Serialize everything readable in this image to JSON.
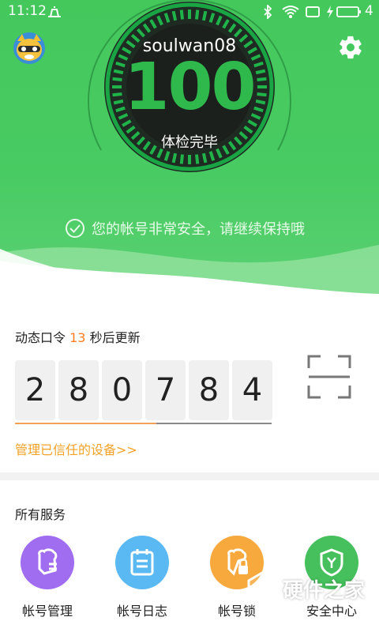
{
  "statusbar": {
    "time": "11:12",
    "battery": "4"
  },
  "profile": {
    "username": "soulwan08"
  },
  "checkup": {
    "score": "100",
    "label": "体检完毕",
    "message": "您的帐号非常安全，请继续保持哦"
  },
  "token": {
    "title_prefix": "动态口令",
    "countdown": "13",
    "title_suffix": "秒后更新",
    "digits": [
      "2",
      "8",
      "0",
      "7",
      "8",
      "4"
    ],
    "progress": 0.55
  },
  "trusted_link": "管理已信任的设备>>",
  "services": {
    "title": "所有服务",
    "items": [
      {
        "label": "帐号管理",
        "color": "#a06cf0",
        "icon": "account-manage-icon"
      },
      {
        "label": "帐号日志",
        "color": "#5ab8f2",
        "icon": "account-log-icon"
      },
      {
        "label": "帐号锁",
        "color": "#f7a93d",
        "icon": "account-lock-icon"
      },
      {
        "label": "安全中心",
        "color": "#45c05c",
        "icon": "security-center-icon"
      }
    ]
  },
  "watermark": "硬件之家",
  "colors": {
    "header_green": "#49cb63",
    "accent_orange": "#ff7d1f",
    "link_orange": "#f3a227"
  }
}
